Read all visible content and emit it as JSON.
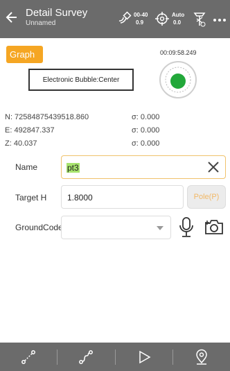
{
  "header": {
    "title": "Detail Survey",
    "subtitle": "Unnamed",
    "sat_top": "00-40",
    "sat_bottom": "0.9",
    "mode_top": "Auto",
    "mode_bottom": "0.0"
  },
  "graph": {
    "button_label": "Graph",
    "bubble_status": "Electronic Bubble:Center",
    "timer": "00:09:58.249"
  },
  "coords": {
    "n": "N: 72584875439518.860",
    "e": "E: 492847.337",
    "z": "Z: 40.037",
    "sigma_n": "σ: 0.000",
    "sigma_e": "σ: 0.000",
    "sigma_z": "σ: 0.000"
  },
  "form": {
    "name_label": "Name",
    "name_value": "pt3",
    "target_h_label": "Target H",
    "target_h_value": "1.8000",
    "pole_label": "Pole(P)",
    "groundcode_label": "GroundCode",
    "groundcode_value": ""
  },
  "colors": {
    "header_bg": "#6b6b6b",
    "accent_orange": "#f5a623",
    "bubble_green": "#22a83a",
    "selection_green": "#a7e36e"
  }
}
